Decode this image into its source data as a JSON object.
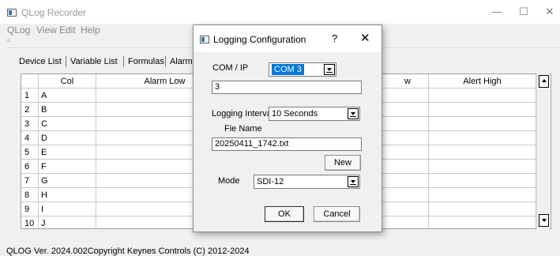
{
  "window": {
    "title": "QLog Recorder",
    "controls": {
      "minimize": "—",
      "maximize": "☐",
      "close": "✕"
    }
  },
  "menu": [
    "QLog",
    "View",
    "Edit",
    "Help"
  ],
  "tabs": [
    {
      "label": "Device List"
    },
    {
      "label": "Variable List"
    },
    {
      "label": "Formulas"
    },
    {
      "label": "Alarm Leve"
    }
  ],
  "grid": {
    "headers": {
      "col": "Col",
      "alarm_low": "Alarm Low",
      "alert_low_partial": "w",
      "alert_high": "Alert High"
    },
    "rows": [
      {
        "num": "1",
        "col": "A"
      },
      {
        "num": "2",
        "col": "B"
      },
      {
        "num": "3",
        "col": "C"
      },
      {
        "num": "4",
        "col": "D"
      },
      {
        "num": "5",
        "col": "E"
      },
      {
        "num": "6",
        "col": "F"
      },
      {
        "num": "7",
        "col": "G"
      },
      {
        "num": "8",
        "col": "H"
      },
      {
        "num": "9",
        "col": "I"
      },
      {
        "num": "10",
        "col": "J"
      }
    ]
  },
  "status": "QLOG Ver. 2024.002Copyright Keynes Controls (C) 2012-2024",
  "dialog": {
    "title": "Logging Configuration",
    "help": "?",
    "close": "✕",
    "com_label": "COM / IP",
    "com_value": "COM 3",
    "com_text": "3",
    "interval_label": "Logging Interval",
    "interval_value": "10 Seconds",
    "file_label": "Fie Name",
    "file_value": "20250411_1742.txt",
    "new_button": "New",
    "mode_label": "Mode",
    "mode_value": "SDI-12",
    "ok_button": "OK",
    "cancel_button": "Cancel"
  }
}
